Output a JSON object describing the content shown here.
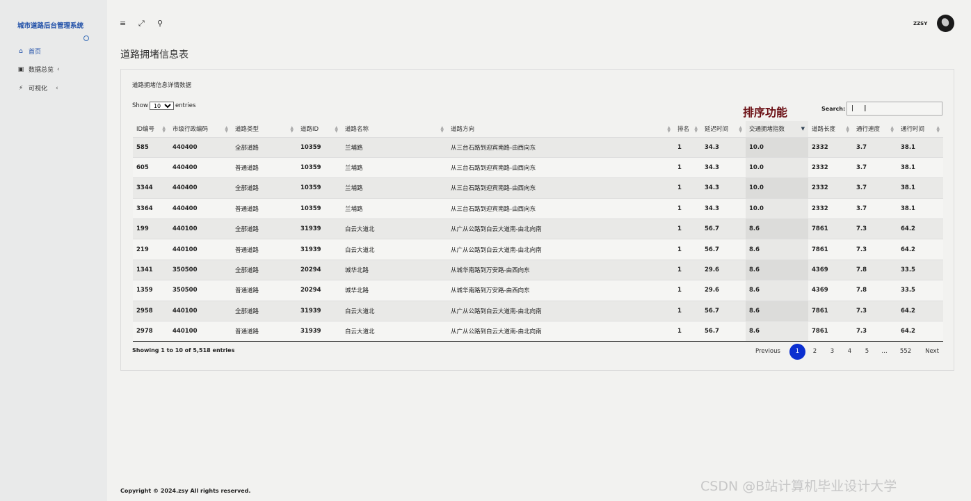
{
  "sidebar": {
    "brand": "城市道路后台管理系统",
    "items": [
      {
        "icon": "home-icon",
        "glyph": "⌂",
        "label": "首页"
      },
      {
        "icon": "monitor-icon",
        "glyph": "▣",
        "label": "数据总览",
        "chevron": "‹"
      },
      {
        "icon": "bolt-icon",
        "glyph": "⚡",
        "label": "可视化",
        "chevron": "‹"
      }
    ]
  },
  "topbar": {
    "menu_icon": "≡",
    "expand_icon": "⤢",
    "search_icon": "⚲",
    "user": "ZZSY"
  },
  "page": {
    "title": "道路拥堵信息表"
  },
  "card": {
    "title": "道路拥堵信息详情数据",
    "show_prefix": "Show",
    "show_value": "10",
    "show_suffix": "entries",
    "annotation": "排序功能",
    "search_label": "Search:",
    "search_value": "|",
    "columns": [
      "ID编号",
      "市级行政编码",
      "道路类型",
      "道路ID",
      "道路名称",
      "道路方向",
      "排名",
      "延迟时间",
      "交通拥堵指数",
      "道路长度",
      "通行速度",
      "通行时间"
    ],
    "sorted_column": "交通拥堵指数",
    "rows": [
      [
        "585",
        "440400",
        "全部道路",
        "10359",
        "兰埔路",
        "从三台石路到迎宾南路-由西向东",
        "1",
        "34.3",
        "10.0",
        "2332",
        "3.7",
        "38.1"
      ],
      [
        "605",
        "440400",
        "普通道路",
        "10359",
        "兰埔路",
        "从三台石路到迎宾南路-由西向东",
        "1",
        "34.3",
        "10.0",
        "2332",
        "3.7",
        "38.1"
      ],
      [
        "3344",
        "440400",
        "全部道路",
        "10359",
        "兰埔路",
        "从三台石路到迎宾南路-由西向东",
        "1",
        "34.3",
        "10.0",
        "2332",
        "3.7",
        "38.1"
      ],
      [
        "3364",
        "440400",
        "普通道路",
        "10359",
        "兰埔路",
        "从三台石路到迎宾南路-由西向东",
        "1",
        "34.3",
        "10.0",
        "2332",
        "3.7",
        "38.1"
      ],
      [
        "199",
        "440100",
        "全部道路",
        "31939",
        "白云大道北",
        "从广从公路到白云大道南-由北向南",
        "1",
        "56.7",
        "8.6",
        "7861",
        "7.3",
        "64.2"
      ],
      [
        "219",
        "440100",
        "普通道路",
        "31939",
        "白云大道北",
        "从广从公路到白云大道南-由北向南",
        "1",
        "56.7",
        "8.6",
        "7861",
        "7.3",
        "64.2"
      ],
      [
        "1341",
        "350500",
        "全部道路",
        "20294",
        "城华北路",
        "从城华南路到万安路-由西向东",
        "1",
        "29.6",
        "8.6",
        "4369",
        "7.8",
        "33.5"
      ],
      [
        "1359",
        "350500",
        "普通道路",
        "20294",
        "城华北路",
        "从城华南路到万安路-由西向东",
        "1",
        "29.6",
        "8.6",
        "4369",
        "7.8",
        "33.5"
      ],
      [
        "2958",
        "440100",
        "全部道路",
        "31939",
        "白云大道北",
        "从广从公路到白云大道南-由北向南",
        "1",
        "56.7",
        "8.6",
        "7861",
        "7.3",
        "64.2"
      ],
      [
        "2978",
        "440100",
        "普通道路",
        "31939",
        "白云大道北",
        "从广从公路到白云大道南-由北向南",
        "1",
        "56.7",
        "8.6",
        "7861",
        "7.3",
        "64.2"
      ]
    ],
    "info": "Showing 1 to 10 of 5,518 entries",
    "pagination": {
      "previous": "Previous",
      "pages": [
        "1",
        "2",
        "3",
        "4",
        "5",
        "…",
        "552"
      ],
      "current": "1",
      "next": "Next"
    }
  },
  "footer": "Copyright © 2024.zsy All rights reserved.",
  "watermark": "CSDN @B站计算机毕业设计大学",
  "colors": {
    "brand": "#1f4fa8",
    "annotation": "#6b0f14",
    "current_page": "#0b2fd0"
  }
}
